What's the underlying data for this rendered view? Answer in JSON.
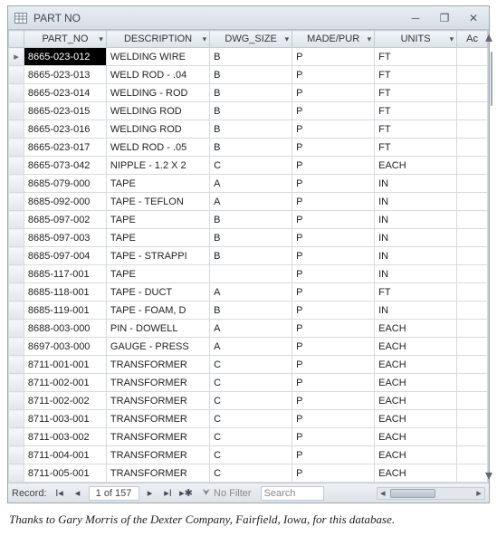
{
  "window": {
    "title": "PART NO"
  },
  "columns": {
    "part_no": "PART_NO",
    "description": "DESCRIPTION",
    "dwg_size": "DWG_SIZE",
    "made_pur": "MADE/PUR",
    "units": "UNITS",
    "add": "Ac"
  },
  "selected_row_index": 0,
  "rows": [
    {
      "part_no": "8665-023-012",
      "description": "WELDING WIRE",
      "dwg": "B",
      "mp": "P",
      "units": "FT"
    },
    {
      "part_no": "8665-023-013",
      "description": "WELD ROD - .04",
      "dwg": "B",
      "mp": "P",
      "units": "FT"
    },
    {
      "part_no": "8665-023-014",
      "description": "WELDING - ROD",
      "dwg": "B",
      "mp": "P",
      "units": "FT"
    },
    {
      "part_no": "8665-023-015",
      "description": "WELDING ROD",
      "dwg": "B",
      "mp": "P",
      "units": "FT"
    },
    {
      "part_no": "8665-023-016",
      "description": "WELDING ROD",
      "dwg": "B",
      "mp": "P",
      "units": "FT"
    },
    {
      "part_no": "8665-023-017",
      "description": "WELD ROD - .05",
      "dwg": "B",
      "mp": "P",
      "units": "FT"
    },
    {
      "part_no": "8665-073-042",
      "description": "NIPPLE - 1.2 X 2",
      "dwg": "C",
      "mp": "P",
      "units": "EACH"
    },
    {
      "part_no": "8685-079-000",
      "description": "TAPE",
      "dwg": "A",
      "mp": "P",
      "units": "IN"
    },
    {
      "part_no": "8685-092-000",
      "description": "TAPE - TEFLON",
      "dwg": "A",
      "mp": "P",
      "units": "IN"
    },
    {
      "part_no": "8685-097-002",
      "description": "TAPE",
      "dwg": "B",
      "mp": "P",
      "units": "IN"
    },
    {
      "part_no": "8685-097-003",
      "description": "TAPE",
      "dwg": "B",
      "mp": "P",
      "units": "IN"
    },
    {
      "part_no": "8685-097-004",
      "description": "TAPE - STRAPPI",
      "dwg": "B",
      "mp": "P",
      "units": "IN"
    },
    {
      "part_no": "8685-117-001",
      "description": "TAPE",
      "dwg": "",
      "mp": "P",
      "units": "IN"
    },
    {
      "part_no": "8685-118-001",
      "description": "TAPE - DUCT",
      "dwg": "A",
      "mp": "P",
      "units": "FT"
    },
    {
      "part_no": "8685-119-001",
      "description": "TAPE - FOAM, D",
      "dwg": "B",
      "mp": "P",
      "units": "IN"
    },
    {
      "part_no": "8688-003-000",
      "description": "PIN - DOWELL",
      "dwg": "A",
      "mp": "P",
      "units": "EACH"
    },
    {
      "part_no": "8697-003-000",
      "description": "GAUGE - PRESS",
      "dwg": "A",
      "mp": "P",
      "units": "EACH"
    },
    {
      "part_no": "8711-001-001",
      "description": "TRANSFORMER",
      "dwg": "C",
      "mp": "P",
      "units": "EACH"
    },
    {
      "part_no": "8711-002-001",
      "description": "TRANSFORMER",
      "dwg": "C",
      "mp": "P",
      "units": "EACH"
    },
    {
      "part_no": "8711-002-002",
      "description": "TRANSFORMER",
      "dwg": "C",
      "mp": "P",
      "units": "EACH"
    },
    {
      "part_no": "8711-003-001",
      "description": "TRANSFORMER",
      "dwg": "C",
      "mp": "P",
      "units": "EACH"
    },
    {
      "part_no": "8711-003-002",
      "description": "TRANSFORMER",
      "dwg": "C",
      "mp": "P",
      "units": "EACH"
    },
    {
      "part_no": "8711-004-001",
      "description": "TRANSFORMER",
      "dwg": "C",
      "mp": "P",
      "units": "EACH"
    },
    {
      "part_no": "8711-005-001",
      "description": "TRANSFORMER",
      "dwg": "C",
      "mp": "P",
      "units": "EACH"
    }
  ],
  "nav": {
    "label": "Record:",
    "position": "1 of 157",
    "nofilter": "No Filter",
    "search_label": "Search"
  },
  "caption": "Thanks to Gary Morris of the Dexter Company, Fairfield, Iowa, for this database."
}
